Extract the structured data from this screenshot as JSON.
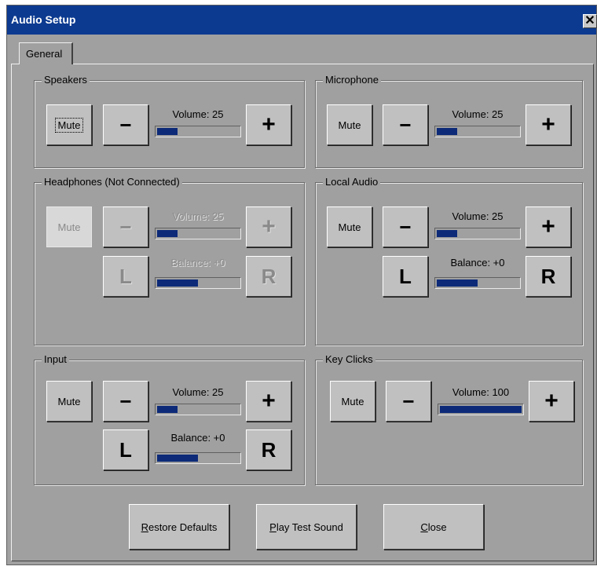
{
  "window": {
    "title": "Audio Setup",
    "close_glyph": "✕"
  },
  "tabs": [
    {
      "label": "General"
    }
  ],
  "groups": {
    "speakers": {
      "label": "Speakers",
      "mute": "Mute",
      "minus": "−",
      "plus": "+",
      "volume_label": "Volume: 25",
      "volume_fraction": 0.25
    },
    "microphone": {
      "label": "Microphone",
      "mute": "Mute",
      "minus": "−",
      "plus": "+",
      "volume_label": "Volume: 25",
      "volume_fraction": 0.25
    },
    "headphones": {
      "label": "Headphones (Not Connected)",
      "mute": "Mute",
      "minus": "−",
      "plus": "+",
      "volume_label": "Volume: 25",
      "volume_fraction": 0.25,
      "left": "L",
      "right": "R",
      "balance_label": "Balance: +0",
      "balance_fraction": 0.5,
      "disabled": true
    },
    "local_audio": {
      "label": "Local Audio",
      "mute": "Mute",
      "minus": "−",
      "plus": "+",
      "volume_label": "Volume: 25",
      "volume_fraction": 0.25,
      "left": "L",
      "right": "R",
      "balance_label": "Balance: +0",
      "balance_fraction": 0.5
    },
    "input": {
      "label": "Input",
      "mute": "Mute",
      "minus": "−",
      "plus": "+",
      "volume_label": "Volume: 25",
      "volume_fraction": 0.25,
      "left": "L",
      "right": "R",
      "balance_label": "Balance: +0",
      "balance_fraction": 0.5
    },
    "key_clicks": {
      "label": "Key Clicks",
      "mute": "Mute",
      "minus": "−",
      "plus": "+",
      "volume_label": "Volume: 100",
      "volume_fraction": 1.0
    }
  },
  "buttons": {
    "restore": {
      "accel": "R",
      "rest": "estore Defaults"
    },
    "play": {
      "accel": "P",
      "rest": "lay Test Sound"
    },
    "close": {
      "accel": "C",
      "rest": "lose"
    }
  },
  "colors": {
    "titlebar": "#0c3a90",
    "dialog": "#a0a0a0",
    "slider_fill": "#0c2a78"
  }
}
